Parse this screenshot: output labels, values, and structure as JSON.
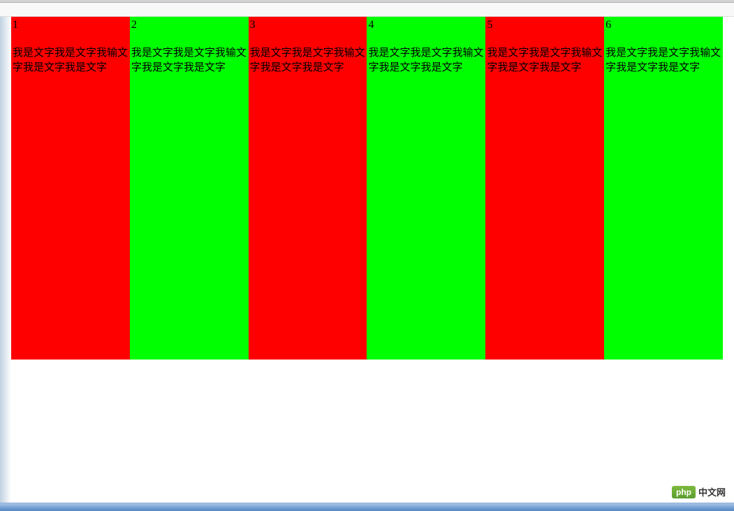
{
  "columns": [
    {
      "number": "1",
      "text": "我是文字我是文字我输文字我是文字我是文字",
      "color": "red"
    },
    {
      "number": "2",
      "text": "我是文字我是文字我输文字我是文字我是文字",
      "color": "green"
    },
    {
      "number": "3",
      "text": "我是文字我是文字我输文字我是文字我是文字",
      "color": "red"
    },
    {
      "number": "4",
      "text": "我是文字我是文字我输文字我是文字我是文字",
      "color": "green"
    },
    {
      "number": "5",
      "text": "我是文字我是文字我输文字我是文字我是文字",
      "color": "red"
    },
    {
      "number": "6",
      "text": "我是文字我是文字我输文字我是文字我是文字",
      "color": "green"
    }
  ],
  "watermark": {
    "badge": "php",
    "label": "中文网"
  },
  "colors": {
    "red": "#ff0000",
    "green": "#00ff00"
  }
}
